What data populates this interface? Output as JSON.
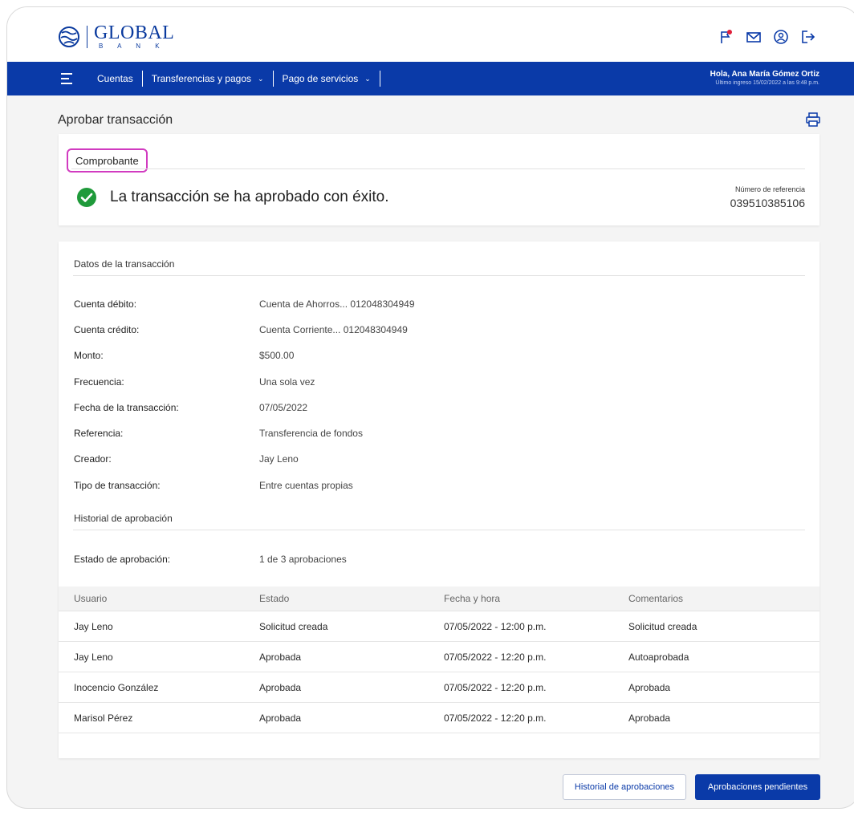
{
  "brand": {
    "name_line1": "GLOBAL",
    "name_line2": "B A N K"
  },
  "nav": {
    "items": [
      {
        "label": "Cuentas",
        "has_dropdown": false
      },
      {
        "label": "Transferencias y pagos",
        "has_dropdown": true
      },
      {
        "label": "Pago de servicios",
        "has_dropdown": true
      }
    ],
    "greeting": "Hola, Ana María Gómez Ortiz",
    "last_login": "Último ingreso 15/02/2022 a las 9:48 p.m."
  },
  "page": {
    "title": "Aprobar transacción"
  },
  "receipt": {
    "tab_label": "Comprobante",
    "success_message": "La transacción se ha aprobado con éxito.",
    "reference_label": "Número de referencia",
    "reference_value": "039510385106"
  },
  "details": {
    "section_title": "Datos de la transacción",
    "fields": [
      {
        "label": "Cuenta débito:",
        "value": "Cuenta de Ahorros... 012048304949"
      },
      {
        "label": "Cuenta crédito:",
        "value": "Cuenta Corriente... 012048304949"
      },
      {
        "label": "Monto:",
        "value": "$500.00"
      },
      {
        "label": "Frecuencia:",
        "value": "Una sola vez"
      },
      {
        "label": "Fecha de la transacción:",
        "value": "07/05/2022"
      },
      {
        "label": "Referencia:",
        "value": "Transferencia de fondos"
      },
      {
        "label": "Creador:",
        "value": "Jay Leno"
      },
      {
        "label": "Tipo de transacción:",
        "value": "Entre cuentas propias"
      }
    ]
  },
  "history": {
    "section_title": "Historial de aprobación",
    "status_label": "Estado de aprobación:",
    "status_value": "1 de 3 aprobaciones",
    "columns": [
      "Usuario",
      "Estado",
      "Fecha y hora",
      "Comentarios"
    ],
    "rows": [
      [
        "Jay Leno",
        "Solicitud creada",
        "07/05/2022 - 12:00 p.m.",
        "Solicitud creada"
      ],
      [
        "Jay Leno",
        "Aprobada",
        "07/05/2022 - 12:20 p.m.",
        "Autoaprobada"
      ],
      [
        "Inocencio González",
        "Aprobada",
        "07/05/2022 - 12:20 p.m.",
        "Aprobada"
      ],
      [
        "Marisol Pérez",
        "Aprobada",
        "07/05/2022 - 12:20 p.m.",
        "Aprobada"
      ]
    ]
  },
  "actions": {
    "history_button": "Historial de aprobaciones",
    "pending_button": "Aprobaciones pendientes"
  },
  "colors": {
    "primary": "#0a3aa8",
    "success": "#1f9a3a",
    "highlight": "#d13bc0",
    "alert_dot": "#e0203a"
  },
  "icons": [
    "globe-logo-icon",
    "flag-icon",
    "mail-icon",
    "user-icon",
    "logout-icon",
    "menu-icon",
    "print-icon",
    "check-circle-icon"
  ]
}
